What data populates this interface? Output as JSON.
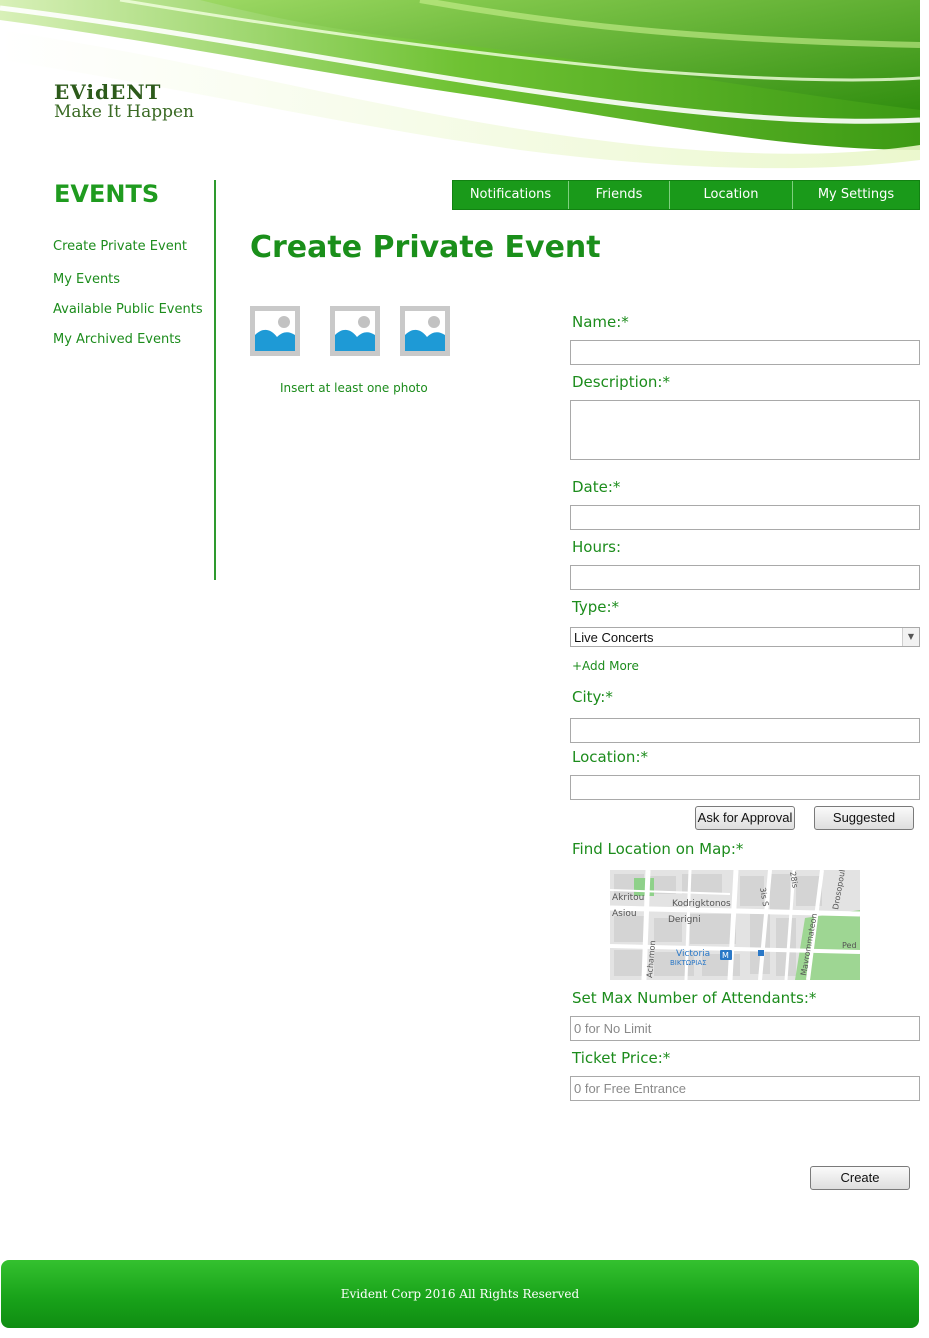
{
  "brand": {
    "name": "EVidENT",
    "tagline": "Make It Happen"
  },
  "sidebar": {
    "heading": "EVENTS",
    "links": [
      "Create Private Event",
      "My Events",
      "Available Public Events",
      "My Archived Events"
    ]
  },
  "topnav": {
    "items": [
      "Notifications",
      "Friends",
      "Location",
      "My Settings"
    ]
  },
  "page": {
    "title": "Create Private Event"
  },
  "photos": {
    "hint": "Insert at least one photo",
    "slots": [
      "image-placeholder-icon",
      "image-placeholder-icon",
      "image-placeholder-icon"
    ]
  },
  "form": {
    "name_label": "Name:*",
    "name_value": "",
    "description_label": "Description:*",
    "description_value": "",
    "date_label": "Date:*",
    "date_value": "",
    "hours_label": "Hours:",
    "hours_value": "",
    "type_label": "Type:*",
    "type_selected": "Live Concerts",
    "add_more": "+Add More",
    "city_label": "City:*",
    "city_value": "",
    "location_label": "Location:*",
    "location_value": "",
    "ask_approval_button": "Ask for Approval",
    "suggested_button": "Suggested",
    "map_label": "Find Location on Map:*",
    "map_streets": [
      "Akritou",
      "Kodrigktonos",
      "Asiou",
      "Derigni",
      "Victoria",
      "ΒΙΚΤΩΡΙΑΣ",
      "Mavrommateon",
      "Achamon",
      "Drosopoul",
      "3is S",
      "28is",
      "Ped"
    ],
    "max_attendants_label": "Set Max Number of Attendants:*",
    "max_attendants_placeholder": "0 for No Limit",
    "ticket_price_label": "Ticket Price:*",
    "ticket_price_placeholder": "0 for Free Entrance",
    "create_button": "Create"
  },
  "footer": {
    "text": "Evident Corp  2016 All Rights Reserved"
  },
  "colors": {
    "brand_green": "#1a9a1a",
    "text_green": "#1c8c1c",
    "footer_green": "#19a31a"
  }
}
